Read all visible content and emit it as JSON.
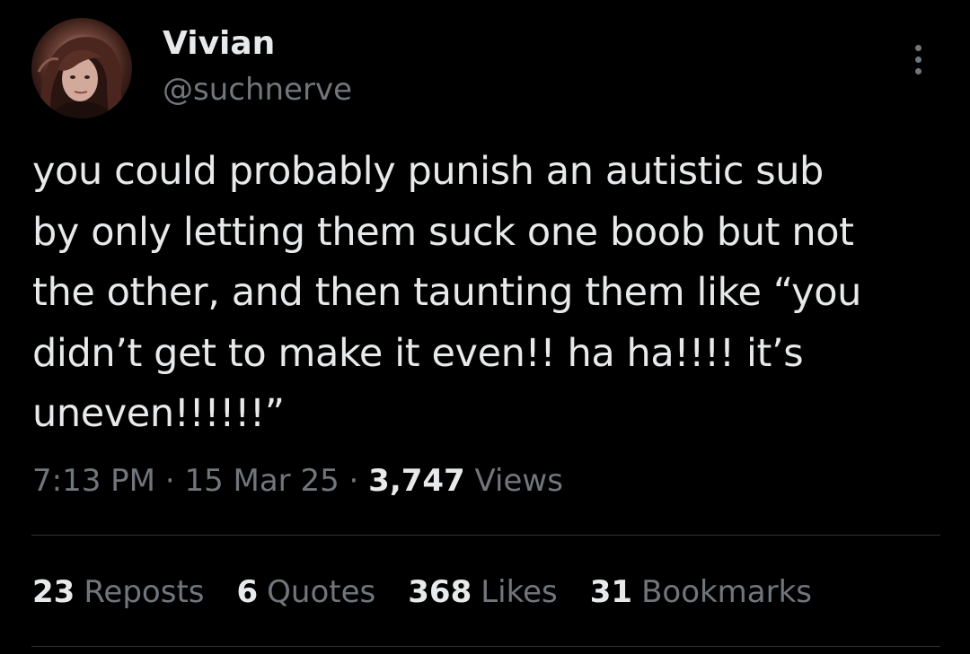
{
  "author": {
    "name": "Vivian",
    "handle": "@suchnerve"
  },
  "tweet": {
    "lines": [
      "you could probably punish an autistic sub",
      "by only letting them suck one boob but not",
      "the other, and then taunting them like “you",
      "didn’t get to make it even!! ha ha!!!! it’s",
      "uneven!!!!!!”"
    ]
  },
  "meta": {
    "time": "7:13 PM",
    "separator_1": "·",
    "date": "15 Mar 25",
    "separator_2": "·",
    "views_count": "3,747",
    "views_label": "Views"
  },
  "stats": {
    "reposts": {
      "count": "23",
      "label": "Reposts"
    },
    "quotes": {
      "count": "6",
      "label": "Quotes"
    },
    "likes": {
      "count": "368",
      "label": "Likes"
    },
    "bookmarks": {
      "count": "31",
      "label": "Bookmarks"
    }
  },
  "icons": {
    "more": "more-options-icon"
  },
  "colors": {
    "background": "#000000",
    "primary_text": "#e7e9ea",
    "secondary_text": "#71767b",
    "divider": "#2f3336"
  }
}
